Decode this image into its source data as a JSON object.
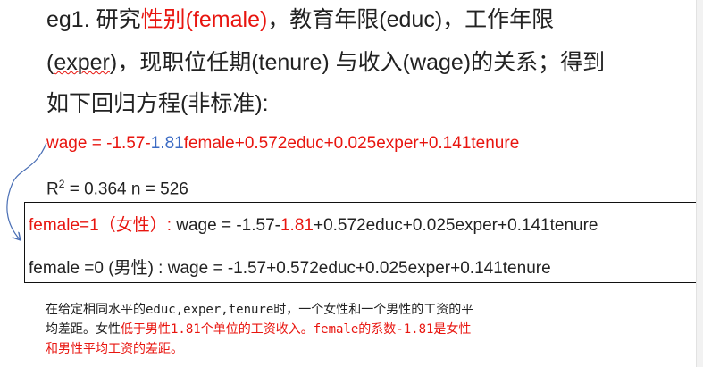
{
  "heading": {
    "line1": {
      "prefix": "eg1. 研究",
      "highlight": "性别(female)",
      "suffix": "，教育年限(educ)，工作年限"
    },
    "line2": {
      "prefix": "(",
      "squiggled": "exper",
      "suffix": ")，现职位任期(tenure) 与收入(wage)的关系；得到"
    },
    "line3": "如下回归方程(非标准):"
  },
  "equation": {
    "lhs": "wage = -1.57-",
    "coef": "1.81",
    "rest": "female+0.572educ+0.025exper+0.141tenure"
  },
  "stats": {
    "r_label": "R",
    "r_sup": "2",
    "r_value": " = 0.364  n = 526"
  },
  "box": {
    "row1": {
      "cond": "female=1（女性）:",
      "lhs": " wage = -1.57-",
      "coef": "1.81",
      "rest": "+0.572educ+0.025exper+0.141tenure"
    },
    "row2": "female =0 (男性) : wage = -1.57+0.572educ+0.025exper+0.141tenure"
  },
  "note": {
    "line1": "在给定相同水平的educ,exper,tenure时，一个女性和一个男性的工资的平",
    "line2_plain": "均差距。女性",
    "line2_red": "低于男性1.81个单位的工资收入。female的系数-1.81是女性",
    "line3_red": "和男性平均工资的差距。"
  },
  "colors": {
    "red": "#e8150f",
    "blue": "#3b6bc4",
    "text": "#222222",
    "arrow": "#4a6fb5"
  }
}
